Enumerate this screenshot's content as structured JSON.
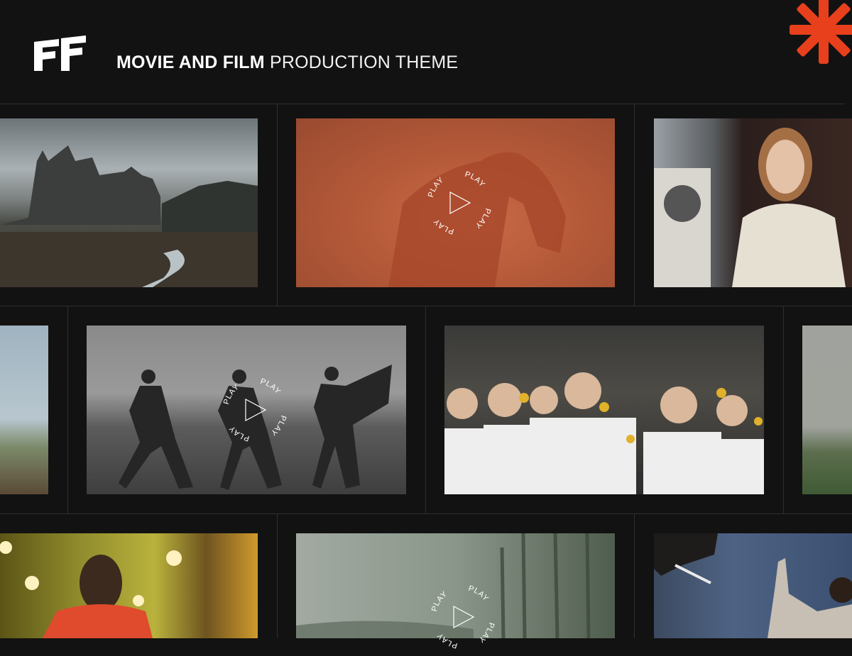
{
  "header": {
    "title_bold": "MOVIE AND FILM",
    "title_light": "PRODUCTION THEME"
  },
  "logo": {
    "icon": "ff-logo-icon",
    "color": "#ffffff"
  },
  "accent": {
    "icon": "asterisk-icon",
    "color": "#e8401c"
  },
  "play_label": "PLAY",
  "tiles": [
    {
      "name": "castle-ruins-photo"
    },
    {
      "name": "woman-orange-fog-video"
    },
    {
      "name": "woman-vintage-portrait-photo"
    },
    {
      "name": "coastal-sky-photo"
    },
    {
      "name": "running-figures-bw-video"
    },
    {
      "name": "choir-boys-daffodils-photo"
    },
    {
      "name": "misty-field-photo"
    },
    {
      "name": "hotel-corridor-girl-photo"
    },
    {
      "name": "foggy-forest-video"
    },
    {
      "name": "conductor-blue-hall-photo"
    }
  ]
}
